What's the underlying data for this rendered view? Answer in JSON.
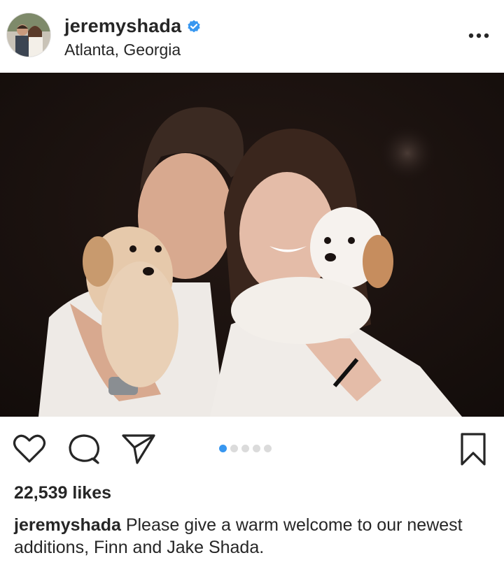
{
  "post": {
    "username": "jeremyshada",
    "location": "Atlanta, Georgia",
    "verified": true,
    "more_icon": "more-horizontal-icon"
  },
  "carousel": {
    "total": 5,
    "active_index": 0
  },
  "actions": {
    "like_icon": "heart-icon",
    "comment_icon": "comment-icon",
    "share_icon": "send-icon",
    "save_icon": "bookmark-icon"
  },
  "likes": {
    "text": "22,539 likes"
  },
  "caption": {
    "username": "jeremyshada",
    "text": "Please give a warm welcome to our newest additions, Finn and Jake Shada."
  },
  "colors": {
    "text": "#262626",
    "verified_blue": "#3897f0",
    "active_dot": "#3897f0",
    "inactive_dot": "#dbdbdb"
  }
}
